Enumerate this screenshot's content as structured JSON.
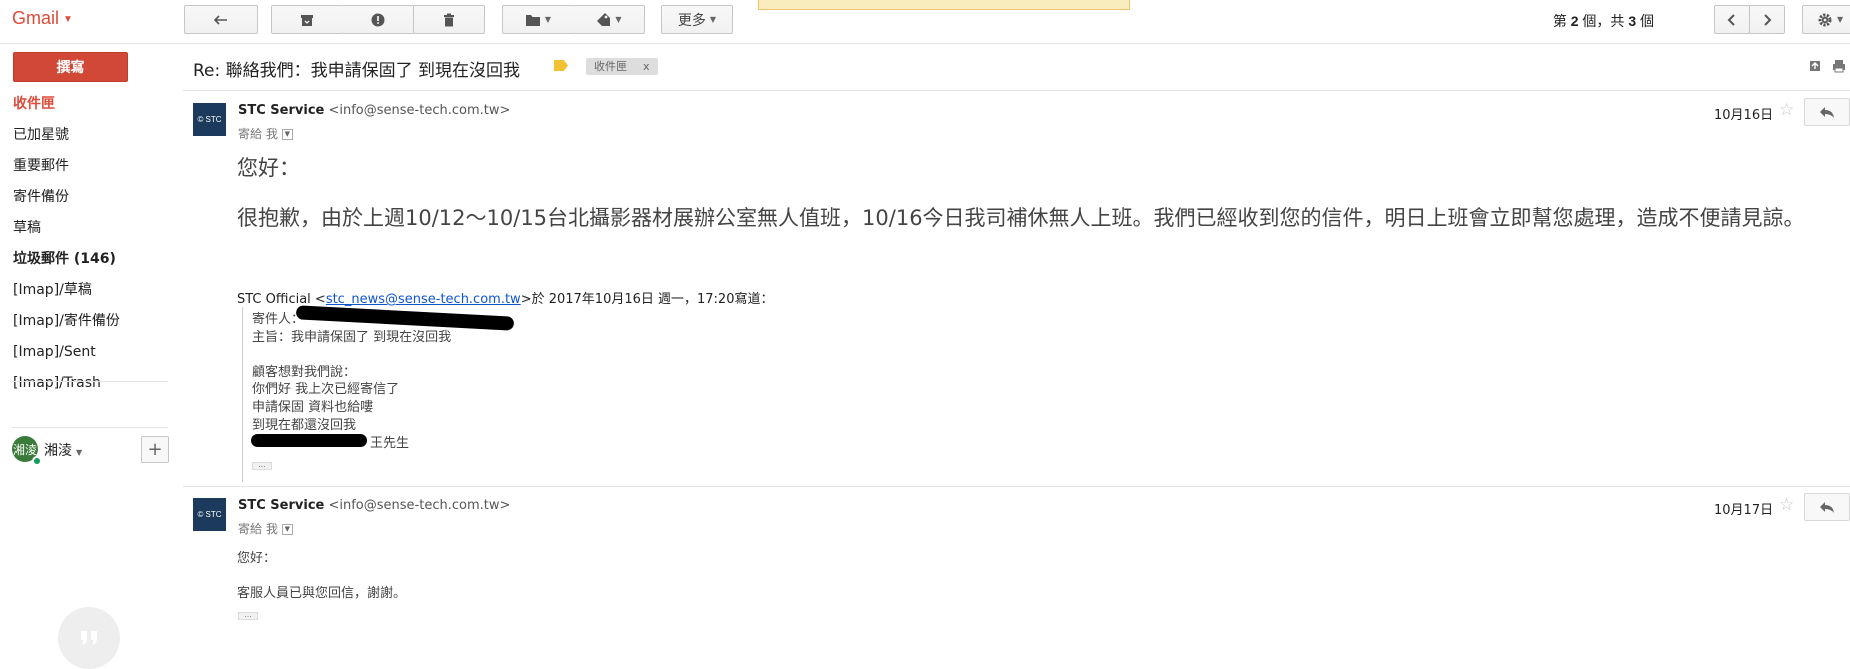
{
  "app": {
    "logo": "Gmail",
    "compose_label": "撰寫"
  },
  "toolbar": {
    "more_label": "更多",
    "pager": {
      "prefix": "第",
      "current": "2",
      "mid": "個，共",
      "total": "3",
      "suffix": "個"
    }
  },
  "nav": {
    "items": [
      {
        "label": "收件匣",
        "style": "active"
      },
      {
        "label": "已加星號",
        "style": ""
      },
      {
        "label": "重要郵件",
        "style": ""
      },
      {
        "label": "寄件備份",
        "style": ""
      },
      {
        "label": "草稿",
        "style": ""
      },
      {
        "label": "垃圾郵件 (146)",
        "style": "bold"
      },
      {
        "label": "[Imap]/草稿",
        "style": ""
      },
      {
        "label": "[Imap]/寄件備份",
        "style": ""
      },
      {
        "label": "[Imap]/Sent",
        "style": ""
      },
      {
        "label": "[Imap]/Trash",
        "style": ""
      }
    ],
    "user": {
      "avatar_text": "湘淩",
      "name": "湘淩"
    }
  },
  "thread": {
    "subject": "Re: 聯絡我們：我申請保固了 到現在沒回我",
    "label_chip": "收件匣",
    "label_chip_close": "x",
    "messages": [
      {
        "logo_text": "© STC",
        "sender_name": "STC Service",
        "sender_email": "<info@sense-tech.com.tw>",
        "to": "寄給 我",
        "date": "10月16日",
        "greeting": "您好：",
        "body": "很抱歉，由於上週10/12～10/15台北攝影器材展辦公室無人值班，10/16今日我司補休無人上班。我們已經收到您的信件，明日上班會立即幫您處理，造成不便請見諒。",
        "quote_header_prefix": "STC Official <",
        "quote_header_email": "stc_news@sense-tech.com.tw",
        "quote_header_suffix": ">於 2017年10月16日 週一，17:20寫道：",
        "quote_lines": [
          "寄件人：",
          "主旨：我申請保固了 到現在沒回我",
          "",
          "顧客想對我們說：",
          "你們好  我上次已經寄信了",
          "申請保固 資料也給嘍",
          "到現在都還沒回我",
          "王先生"
        ],
        "ellipsis": "..."
      },
      {
        "logo_text": "© STC",
        "sender_name": "STC Service",
        "sender_email": "<info@sense-tech.com.tw>",
        "to": "寄給 我",
        "date": "10月17日",
        "greeting": "您好：",
        "body": "客服人員已與您回信，謝謝。",
        "ellipsis": "..."
      }
    ]
  },
  "colors": {
    "accent": "#dd4b39",
    "compose": "#d14836",
    "link": "#1155cc"
  }
}
